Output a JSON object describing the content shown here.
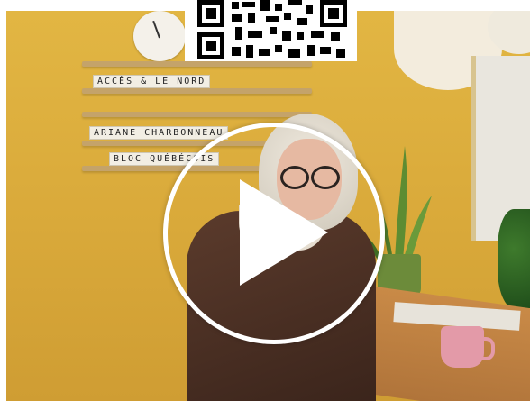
{
  "video": {
    "sign_line1": "ACCÈS & LE NORD",
    "sign_line2": "ARIANE CHARBONNEAU",
    "sign_line3": "BLOC QUÉBÉCOIS",
    "play_icon": "play-icon",
    "qr_icon": "qr-code-icon"
  },
  "colors": {
    "wall": "#d9a93a",
    "play_overlay": "#ffffff"
  }
}
